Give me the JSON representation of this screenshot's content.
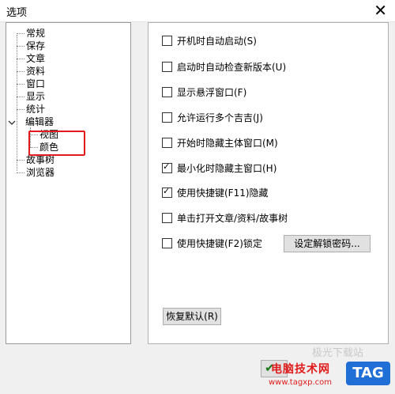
{
  "window": {
    "title": "选项",
    "close_icon": "close-icon"
  },
  "tree": {
    "items": [
      {
        "label": "常规",
        "selected": true
      },
      {
        "label": "保存"
      },
      {
        "label": "文章"
      },
      {
        "label": "资料"
      },
      {
        "label": "窗口"
      },
      {
        "label": "显示"
      },
      {
        "label": "统计"
      },
      {
        "label": "编辑器",
        "expanded": true,
        "children": [
          {
            "label": "视图"
          },
          {
            "label": "颜色"
          }
        ]
      },
      {
        "label": "故事树"
      },
      {
        "label": "浏览器"
      }
    ]
  },
  "options": [
    {
      "label": "开机时自动启动(S)",
      "checked": false
    },
    {
      "label": "启动时自动检查新版本(U)",
      "checked": false
    },
    {
      "label": "显示悬浮窗口(F)",
      "checked": false
    },
    {
      "label": "允许运行多个吉吉(J)",
      "checked": false
    },
    {
      "label": "开始时隐藏主体窗口(M)",
      "checked": false
    },
    {
      "label": "最小化时隐藏主窗口(H)",
      "checked": true
    },
    {
      "label": "使用快捷键(F11)隐藏",
      "checked": true
    },
    {
      "label": "单击打开文章/资料/故事树",
      "checked": false
    },
    {
      "label": "使用快捷键(F2)锁定",
      "checked": false
    }
  ],
  "buttons": {
    "set_unlock_password": "设定解锁密码...",
    "restore_default": "恢复默认(R)"
  },
  "watermark": {
    "site_name": "电脑技术网",
    "url": "www.tagxp.com",
    "tag": "TAG",
    "faded": "极光下载站"
  },
  "colors": {
    "highlight_box": "#e01b1b",
    "tag_bg": "#1f6fd6"
  }
}
